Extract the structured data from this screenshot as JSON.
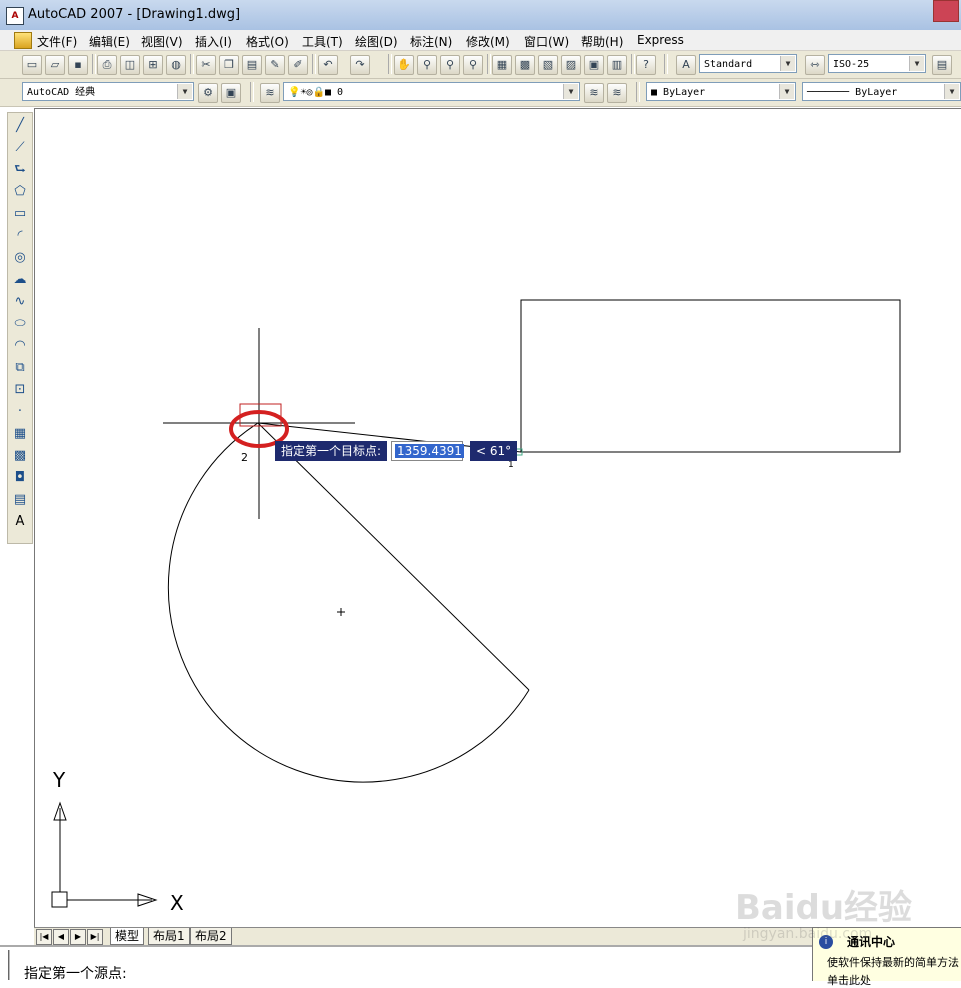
{
  "window": {
    "title": "AutoCAD 2007 - [Drawing1.dwg]",
    "icon": "autocad-app-icon"
  },
  "menu": {
    "items": [
      "文件(F)",
      "编辑(E)",
      "视图(V)",
      "插入(I)",
      "格式(O)",
      "工具(T)",
      "绘图(D)",
      "标注(N)",
      "修改(M)",
      "窗口(W)",
      "帮助(H)",
      "Express"
    ]
  },
  "toolbar": {
    "text_style": "Standard",
    "dim_style": "ISO-25",
    "workspace": "AutoCAD 经典",
    "layer": "0",
    "color": "ByLayer",
    "linetype": "ByLayer"
  },
  "drawing_tooltip": {
    "prompt": "指定第一个目标点:",
    "distance": "1359.4391",
    "angle": "< 61°",
    "point_label_2": "2",
    "point_label_1": "1"
  },
  "ucs": {
    "x_label": "X",
    "y_label": "Y"
  },
  "tabs": {
    "model": "模型",
    "layout1": "布局1",
    "layout2": "布局2"
  },
  "command_line": {
    "text": "指定第一个源点:"
  },
  "notification": {
    "title": "通讯中心",
    "body": "使软件保持最新的简单方法",
    "more": "单击此处"
  },
  "watermark": {
    "logo": "Baidu经验",
    "url": "jingyan.baidu.com"
  },
  "colors": {
    "highlight_circle": "#d42020",
    "tooltip_bg": "#1e2a6e",
    "selection_blue": "#3366cc"
  }
}
